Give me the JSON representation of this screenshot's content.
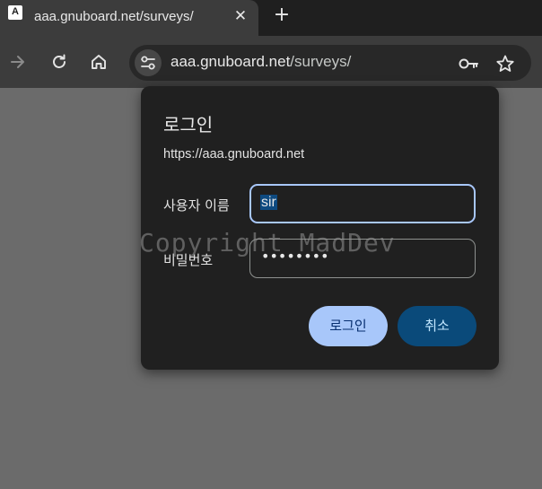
{
  "browser": {
    "tab": {
      "title": "aaa.gnuboard.net/surveys/",
      "favicon_letter": "A",
      "close_icon": "close-icon"
    },
    "new_tab_icon": "plus-icon",
    "toolbar": {
      "forward_icon": "arrow-forward-icon",
      "reload_icon": "reload-icon",
      "home_icon": "home-icon",
      "site_info_icon": "tune-icon",
      "url_host": "aaa.gnuboard.net",
      "url_path": "/surveys/",
      "password_key_icon": "key-icon",
      "bookmark_icon": "star-icon"
    }
  },
  "watermark": "Copyright MadDev",
  "dialog": {
    "title": "로그인",
    "origin": "https://aaa.gnuboard.net",
    "username_label": "사용자 이름",
    "username_value": "sir",
    "password_label": "비밀번호",
    "password_mask": "••••••••",
    "login_button": "로그인",
    "cancel_button": "취소"
  },
  "colors": {
    "accent": "#a8c7fa",
    "cancel_bg": "#0a4a7a",
    "dialog_bg": "#202020",
    "page_bg": "#6b6b6b"
  }
}
